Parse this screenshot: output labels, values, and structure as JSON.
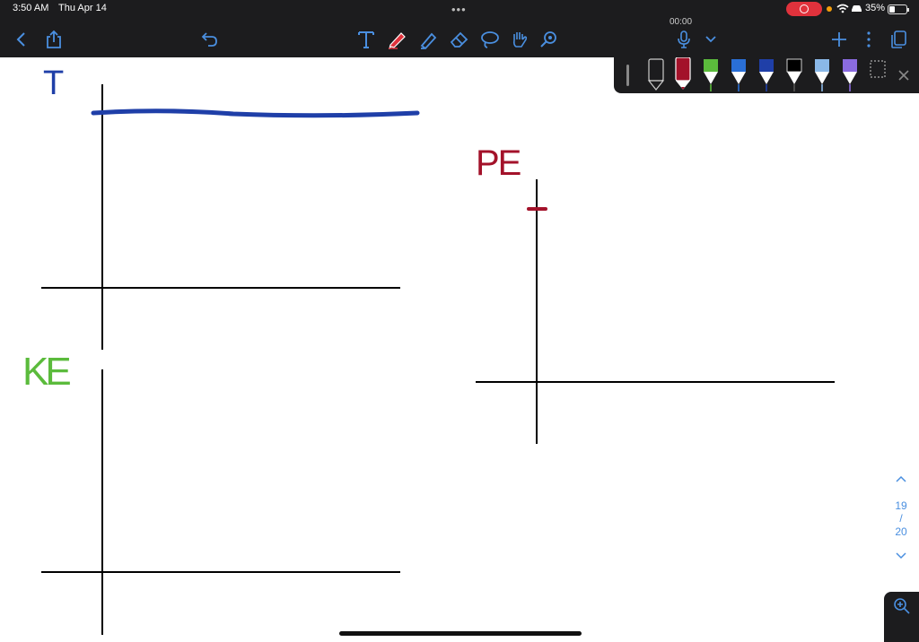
{
  "status_bar": {
    "time": "3:50 AM",
    "date": "Thu Apr 14",
    "battery": "35%"
  },
  "toolbar": {
    "timer": "00:00"
  },
  "canvas": {
    "labels": {
      "t": "T",
      "pe": "PE",
      "ke": "KE"
    }
  },
  "pager": {
    "current": "19",
    "separator": "/",
    "total": "20"
  },
  "colors": {
    "accent": "#4a8fe0",
    "blue_ink": "#1f3fa8",
    "red_ink": "#a3122a",
    "green_ink": "#5bbb3c",
    "toolbar_bg": "#1c1c1e",
    "record": "#e0323c"
  },
  "icons": {
    "back": "chevron-left-icon",
    "share": "share-icon",
    "undo": "undo-icon",
    "text_tool": "text-tool-icon",
    "pen_tool": "pen-tool-icon",
    "highlighter_tool": "highlighter-tool-icon",
    "eraser_tool": "eraser-tool-icon",
    "lasso_tool": "lasso-tool-icon",
    "hand_tool": "hand-tool-icon",
    "shape_tool": "shape-tool-icon",
    "microphone": "microphone-icon",
    "add": "plus-icon",
    "more": "more-icon",
    "pages": "pages-icon",
    "zoom": "zoom-in-icon"
  }
}
